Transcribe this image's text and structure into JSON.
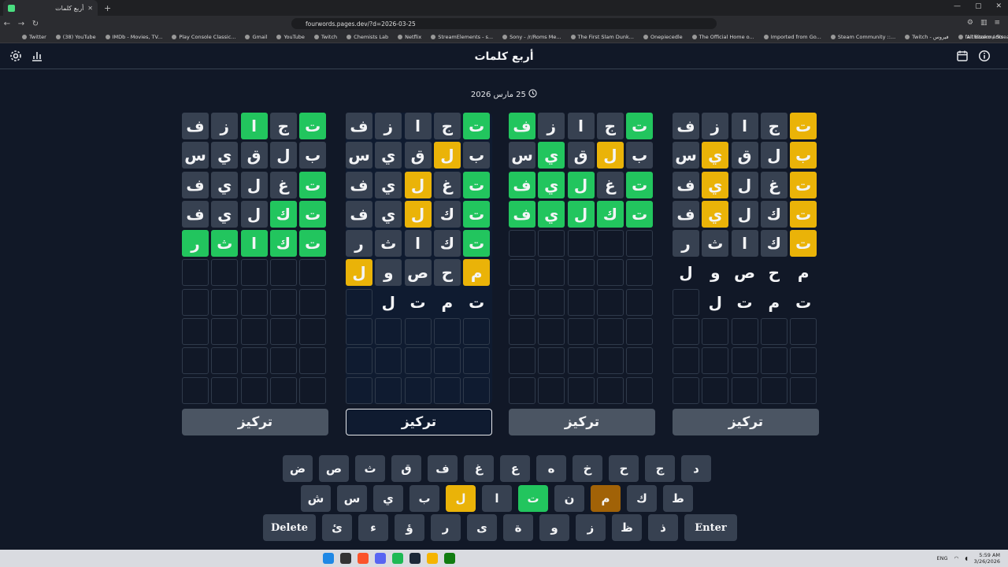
{
  "browser": {
    "tab_title": "أربع كلمات",
    "url": "fourwords.pages.dev/?d=2026-03-25",
    "bookmarks": [
      "Twitter",
      "(38) YouTube",
      "IMDb - Movies, TV...",
      "Play Console Classic...",
      "Gmail",
      "YouTube",
      "Twitch",
      "Chemists Lab",
      "Netflix",
      "StreamElements - s...",
      "Sony - /r/Roms Me...",
      "The First Slam Dunk...",
      "Onepiecedle",
      "The Official Home o...",
      "Imported from Go...",
      "Steam Community ::...",
      "Twitch - فيروس",
      "faith0zero / Streaml..."
    ],
    "all_bookmarks": "All Bookmarks"
  },
  "header": {
    "title": "أربع كلمات",
    "settings_icon": "gear-icon",
    "stats_icon": "bar-chart-icon",
    "calendar_icon": "calendar-icon",
    "info_icon": "info-icon"
  },
  "date": {
    "text": "25 مارس 2026",
    "icon": "clock-icon"
  },
  "colors": {
    "green": "#22c55e",
    "yellow": "#eab308",
    "tile": "#374151",
    "background": "#111827"
  },
  "boards": [
    {
      "active": false,
      "focus_label": "تركيز",
      "rows": [
        [
          [
            "ت",
            "green"
          ],
          [
            "ج",
            "filled"
          ],
          [
            "ا",
            "green"
          ],
          [
            "ز",
            "filled"
          ],
          [
            "ف",
            "filled"
          ]
        ],
        [
          [
            "ب",
            "filled"
          ],
          [
            "ل",
            "filled"
          ],
          [
            "ق",
            "filled"
          ],
          [
            "ي",
            "filled"
          ],
          [
            "س",
            "filled"
          ]
        ],
        [
          [
            "ت",
            "green"
          ],
          [
            "غ",
            "filled"
          ],
          [
            "ل",
            "filled"
          ],
          [
            "ي",
            "filled"
          ],
          [
            "ف",
            "filled"
          ]
        ],
        [
          [
            "ت",
            "green"
          ],
          [
            "ك",
            "green"
          ],
          [
            "ل",
            "filled"
          ],
          [
            "ي",
            "filled"
          ],
          [
            "ف",
            "filled"
          ]
        ],
        [
          [
            "ت",
            "green"
          ],
          [
            "ك",
            "green"
          ],
          [
            "ا",
            "green"
          ],
          [
            "ث",
            "green"
          ],
          [
            "ر",
            "green"
          ]
        ],
        [
          [
            "",
            "empty"
          ],
          [
            "",
            "empty"
          ],
          [
            "",
            "empty"
          ],
          [
            "",
            "empty"
          ],
          [
            "",
            "empty"
          ]
        ],
        [
          [
            "",
            "empty"
          ],
          [
            "",
            "empty"
          ],
          [
            "",
            "empty"
          ],
          [
            "",
            "empty"
          ],
          [
            "",
            "empty"
          ]
        ],
        [
          [
            "",
            "empty"
          ],
          [
            "",
            "empty"
          ],
          [
            "",
            "empty"
          ],
          [
            "",
            "empty"
          ],
          [
            "",
            "empty"
          ]
        ],
        [
          [
            "",
            "empty"
          ],
          [
            "",
            "empty"
          ],
          [
            "",
            "empty"
          ],
          [
            "",
            "empty"
          ],
          [
            "",
            "empty"
          ]
        ],
        [
          [
            "",
            "empty"
          ],
          [
            "",
            "empty"
          ],
          [
            "",
            "empty"
          ],
          [
            "",
            "empty"
          ],
          [
            "",
            "empty"
          ]
        ]
      ]
    },
    {
      "active": true,
      "focus_label": "تركيز",
      "rows": [
        [
          [
            "ت",
            "green"
          ],
          [
            "ج",
            "filled"
          ],
          [
            "ا",
            "filled"
          ],
          [
            "ز",
            "filled"
          ],
          [
            "ف",
            "filled"
          ]
        ],
        [
          [
            "ب",
            "filled"
          ],
          [
            "ل",
            "yellow"
          ],
          [
            "ق",
            "filled"
          ],
          [
            "ي",
            "filled"
          ],
          [
            "س",
            "filled"
          ]
        ],
        [
          [
            "ت",
            "green"
          ],
          [
            "غ",
            "filled"
          ],
          [
            "ل",
            "yellow"
          ],
          [
            "ي",
            "filled"
          ],
          [
            "ف",
            "filled"
          ]
        ],
        [
          [
            "ت",
            "green"
          ],
          [
            "ك",
            "filled"
          ],
          [
            "ل",
            "yellow"
          ],
          [
            "ي",
            "filled"
          ],
          [
            "ف",
            "filled"
          ]
        ],
        [
          [
            "ت",
            "green"
          ],
          [
            "ك",
            "filled"
          ],
          [
            "ا",
            "filled"
          ],
          [
            "ث",
            "filled"
          ],
          [
            "ر",
            "filled"
          ]
        ],
        [
          [
            "م",
            "yellow"
          ],
          [
            "ح",
            "filled"
          ],
          [
            "ص",
            "filled"
          ],
          [
            "و",
            "filled"
          ],
          [
            "ل",
            "yellow"
          ]
        ],
        [
          [
            "ت",
            "plain"
          ],
          [
            "م",
            "plain"
          ],
          [
            "ت",
            "plain"
          ],
          [
            "ل",
            "plain"
          ],
          [
            "",
            "empty"
          ]
        ],
        [
          [
            "",
            "empty"
          ],
          [
            "",
            "empty"
          ],
          [
            "",
            "empty"
          ],
          [
            "",
            "empty"
          ],
          [
            "",
            "empty"
          ]
        ],
        [
          [
            "",
            "empty"
          ],
          [
            "",
            "empty"
          ],
          [
            "",
            "empty"
          ],
          [
            "",
            "empty"
          ],
          [
            "",
            "empty"
          ]
        ],
        [
          [
            "",
            "empty"
          ],
          [
            "",
            "empty"
          ],
          [
            "",
            "empty"
          ],
          [
            "",
            "empty"
          ],
          [
            "",
            "empty"
          ]
        ]
      ]
    },
    {
      "active": false,
      "focus_label": "تركيز",
      "rows": [
        [
          [
            "ت",
            "green"
          ],
          [
            "ج",
            "filled"
          ],
          [
            "ا",
            "filled"
          ],
          [
            "ز",
            "filled"
          ],
          [
            "ف",
            "green"
          ]
        ],
        [
          [
            "ب",
            "filled"
          ],
          [
            "ل",
            "yellow"
          ],
          [
            "ق",
            "filled"
          ],
          [
            "ي",
            "green"
          ],
          [
            "س",
            "filled"
          ]
        ],
        [
          [
            "ت",
            "green"
          ],
          [
            "غ",
            "filled"
          ],
          [
            "ل",
            "green"
          ],
          [
            "ي",
            "green"
          ],
          [
            "ف",
            "green"
          ]
        ],
        [
          [
            "ت",
            "green"
          ],
          [
            "ك",
            "green"
          ],
          [
            "ل",
            "green"
          ],
          [
            "ي",
            "green"
          ],
          [
            "ف",
            "green"
          ]
        ],
        [
          [
            "",
            "empty"
          ],
          [
            "",
            "empty"
          ],
          [
            "",
            "empty"
          ],
          [
            "",
            "empty"
          ],
          [
            "",
            "empty"
          ]
        ],
        [
          [
            "",
            "empty"
          ],
          [
            "",
            "empty"
          ],
          [
            "",
            "empty"
          ],
          [
            "",
            "empty"
          ],
          [
            "",
            "empty"
          ]
        ],
        [
          [
            "",
            "empty"
          ],
          [
            "",
            "empty"
          ],
          [
            "",
            "empty"
          ],
          [
            "",
            "empty"
          ],
          [
            "",
            "empty"
          ]
        ],
        [
          [
            "",
            "empty"
          ],
          [
            "",
            "empty"
          ],
          [
            "",
            "empty"
          ],
          [
            "",
            "empty"
          ],
          [
            "",
            "empty"
          ]
        ],
        [
          [
            "",
            "empty"
          ],
          [
            "",
            "empty"
          ],
          [
            "",
            "empty"
          ],
          [
            "",
            "empty"
          ],
          [
            "",
            "empty"
          ]
        ],
        [
          [
            "",
            "empty"
          ],
          [
            "",
            "empty"
          ],
          [
            "",
            "empty"
          ],
          [
            "",
            "empty"
          ],
          [
            "",
            "empty"
          ]
        ]
      ]
    },
    {
      "active": false,
      "focus_label": "تركيز",
      "rows": [
        [
          [
            "ت",
            "yellow"
          ],
          [
            "ج",
            "filled"
          ],
          [
            "ا",
            "filled"
          ],
          [
            "ز",
            "filled"
          ],
          [
            "ف",
            "filled"
          ]
        ],
        [
          [
            "ب",
            "yellow"
          ],
          [
            "ل",
            "filled"
          ],
          [
            "ق",
            "filled"
          ],
          [
            "ي",
            "yellow"
          ],
          [
            "س",
            "filled"
          ]
        ],
        [
          [
            "ت",
            "yellow"
          ],
          [
            "غ",
            "filled"
          ],
          [
            "ل",
            "filled"
          ],
          [
            "ي",
            "yellow"
          ],
          [
            "ف",
            "filled"
          ]
        ],
        [
          [
            "ت",
            "yellow"
          ],
          [
            "ك",
            "filled"
          ],
          [
            "ل",
            "filled"
          ],
          [
            "ي",
            "yellow"
          ],
          [
            "ف",
            "filled"
          ]
        ],
        [
          [
            "ت",
            "yellow"
          ],
          [
            "ك",
            "filled"
          ],
          [
            "ا",
            "filled"
          ],
          [
            "ث",
            "filled"
          ],
          [
            "ر",
            "filled"
          ]
        ],
        [
          [
            "م",
            "plain"
          ],
          [
            "ح",
            "plain"
          ],
          [
            "ص",
            "plain"
          ],
          [
            "و",
            "plain"
          ],
          [
            "ل",
            "plain"
          ]
        ],
        [
          [
            "ت",
            "plain"
          ],
          [
            "م",
            "plain"
          ],
          [
            "ت",
            "plain"
          ],
          [
            "ل",
            "plain"
          ],
          [
            "",
            "empty"
          ]
        ],
        [
          [
            "",
            "empty"
          ],
          [
            "",
            "empty"
          ],
          [
            "",
            "empty"
          ],
          [
            "",
            "empty"
          ],
          [
            "",
            "empty"
          ]
        ],
        [
          [
            "",
            "empty"
          ],
          [
            "",
            "empty"
          ],
          [
            "",
            "empty"
          ],
          [
            "",
            "empty"
          ],
          [
            "",
            "empty"
          ]
        ],
        [
          [
            "",
            "empty"
          ],
          [
            "",
            "empty"
          ],
          [
            "",
            "empty"
          ],
          [
            "",
            "empty"
          ],
          [
            "",
            "empty"
          ]
        ]
      ]
    }
  ],
  "keyboard": {
    "row1": [
      [
        "د",
        "default"
      ],
      [
        "ج",
        "default"
      ],
      [
        "ح",
        "default"
      ],
      [
        "خ",
        "default"
      ],
      [
        "ه",
        "default"
      ],
      [
        "ع",
        "default"
      ],
      [
        "غ",
        "default"
      ],
      [
        "ف",
        "default"
      ],
      [
        "ق",
        "default"
      ],
      [
        "ث",
        "default"
      ],
      [
        "ص",
        "default"
      ],
      [
        "ض",
        "default"
      ]
    ],
    "row2": [
      [
        "ط",
        "default"
      ],
      [
        "ك",
        "default"
      ],
      [
        "م",
        "orange"
      ],
      [
        "ن",
        "default"
      ],
      [
        "ت",
        "green"
      ],
      [
        "ا",
        "default"
      ],
      [
        "ل",
        "yellow"
      ],
      [
        "ب",
        "default"
      ],
      [
        "ي",
        "default"
      ],
      [
        "س",
        "default"
      ],
      [
        "ش",
        "default"
      ]
    ],
    "row3": [
      [
        "Enter",
        "wide"
      ],
      [
        "ذ",
        "default"
      ],
      [
        "ظ",
        "default"
      ],
      [
        "ز",
        "default"
      ],
      [
        "و",
        "default"
      ],
      [
        "ة",
        "default"
      ],
      [
        "ى",
        "default"
      ],
      [
        "ر",
        "default"
      ],
      [
        "ؤ",
        "default"
      ],
      [
        "ء",
        "default"
      ],
      [
        "ئ",
        "default"
      ],
      [
        "Delete",
        "wide"
      ]
    ]
  },
  "taskbar": {
    "lang": "ENG",
    "time": "5:59 AM",
    "date": "3/26/2026"
  }
}
